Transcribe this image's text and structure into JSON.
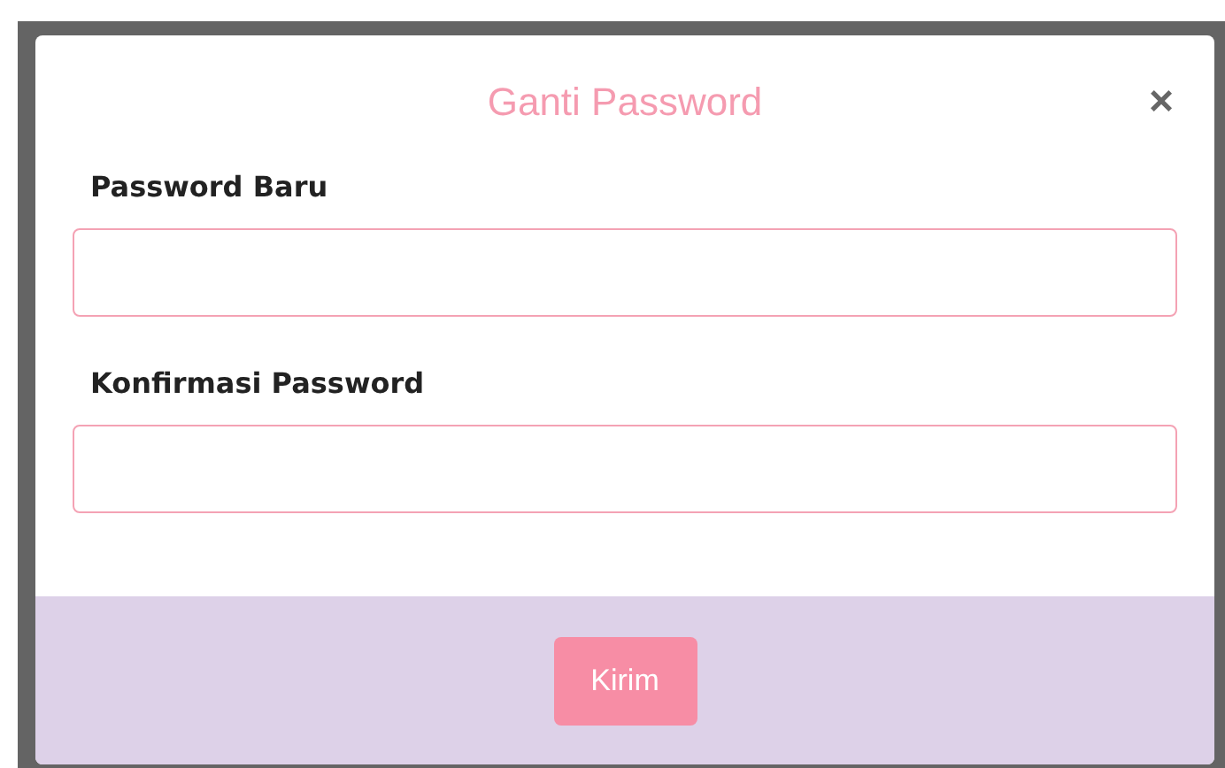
{
  "modal": {
    "title": "Ganti Password",
    "close": "×",
    "fields": [
      {
        "label": "Password Baru"
      },
      {
        "label": "Konfirmasi Password"
      }
    ],
    "submit": "Kirim"
  }
}
